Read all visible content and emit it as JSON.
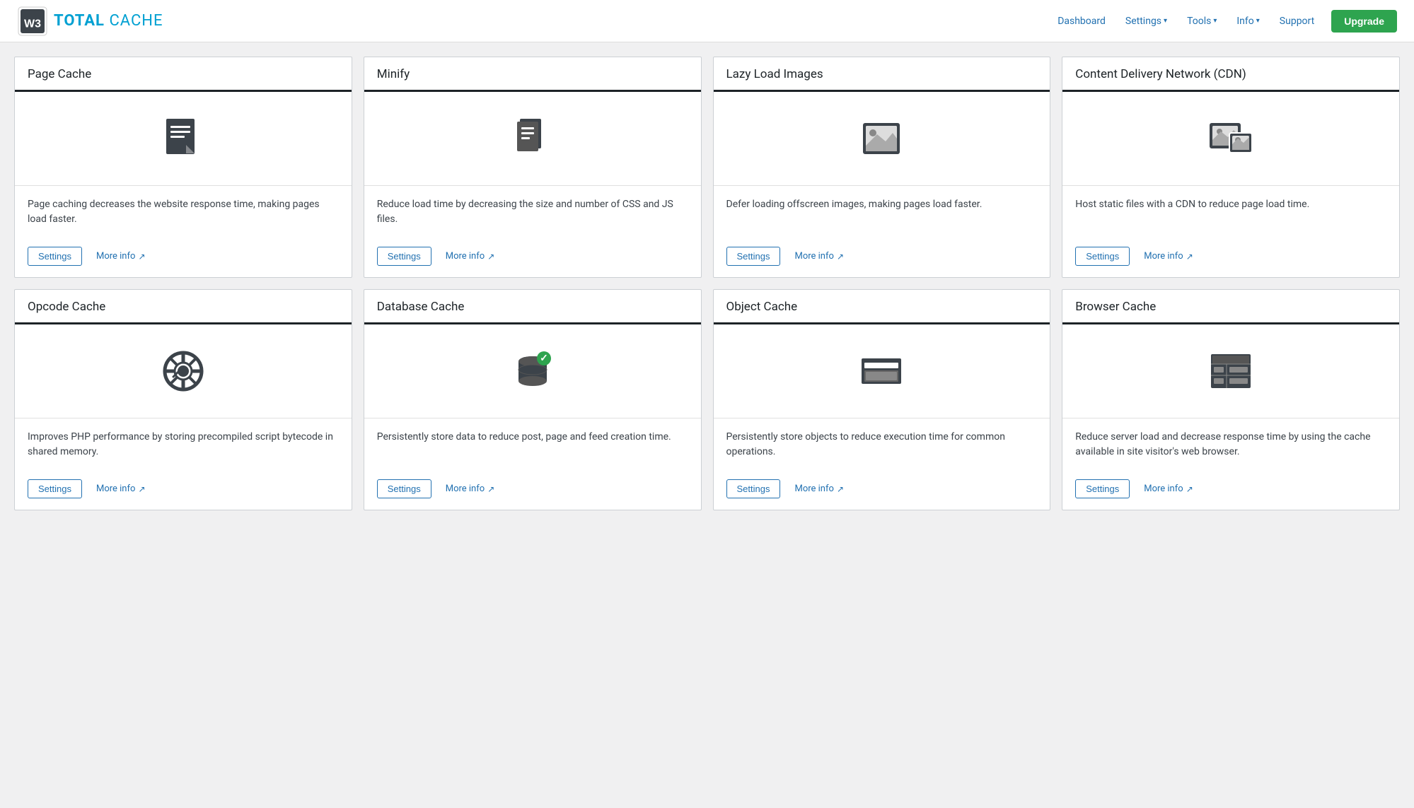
{
  "brand": {
    "name_part1": "TOTAL",
    "name_part2": "CACHE",
    "logo_aria": "W3 Total Cache"
  },
  "nav": {
    "items": [
      {
        "label": "Dashboard",
        "has_dropdown": false
      },
      {
        "label": "Settings",
        "has_dropdown": true
      },
      {
        "label": "Tools",
        "has_dropdown": true
      },
      {
        "label": "Info",
        "has_dropdown": true
      },
      {
        "label": "Support",
        "has_dropdown": false
      }
    ],
    "upgrade_label": "Upgrade"
  },
  "cards": [
    {
      "id": "page-cache",
      "title": "Page Cache",
      "description": "Page caching decreases the website response time, making pages load faster.",
      "icon": "page-cache",
      "settings_label": "Settings",
      "more_info_label": "More info"
    },
    {
      "id": "minify",
      "title": "Minify",
      "description": "Reduce load time by decreasing the size and number of CSS and JS files.",
      "icon": "minify",
      "settings_label": "Settings",
      "more_info_label": "More info"
    },
    {
      "id": "lazy-load",
      "title": "Lazy Load Images",
      "description": "Defer loading offscreen images, making pages load faster.",
      "icon": "lazy-load",
      "settings_label": "Settings",
      "more_info_label": "More info"
    },
    {
      "id": "cdn",
      "title": "Content Delivery Network (CDN)",
      "description": "Host static files with a CDN to reduce page load time.",
      "icon": "cdn",
      "settings_label": "Settings",
      "more_info_label": "More info"
    },
    {
      "id": "opcode-cache",
      "title": "Opcode Cache",
      "description": "Improves PHP performance by storing precompiled script bytecode in shared memory.",
      "icon": "opcode",
      "settings_label": "Settings",
      "more_info_label": "More info"
    },
    {
      "id": "database-cache",
      "title": "Database Cache",
      "description": "Persistently store data to reduce post, page and feed creation time.",
      "icon": "database",
      "settings_label": "Settings",
      "more_info_label": "More info"
    },
    {
      "id": "object-cache",
      "title": "Object Cache",
      "description": "Persistently store objects to reduce execution time for common operations.",
      "icon": "object",
      "settings_label": "Settings",
      "more_info_label": "More info"
    },
    {
      "id": "browser-cache",
      "title": "Browser Cache",
      "description": "Reduce server load and decrease response time by using the cache available in site visitor's web browser.",
      "icon": "browser",
      "settings_label": "Settings",
      "more_info_label": "More info"
    }
  ]
}
